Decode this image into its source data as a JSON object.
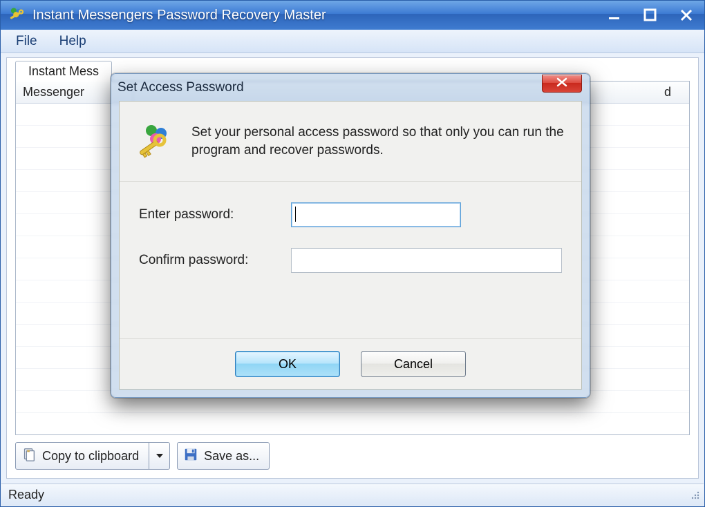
{
  "main_window": {
    "title": "Instant Messengers Password Recovery Master",
    "menubar": {
      "file": "File",
      "help": "Help"
    },
    "tabs": [
      {
        "label": "Instant Mess"
      }
    ],
    "columns": {
      "messenger": "Messenger",
      "right": "d"
    },
    "toolbar": {
      "copy_label": "Copy to clipboard",
      "save_label": "Save as..."
    },
    "status": "Ready"
  },
  "dialog": {
    "title": "Set Access Password",
    "description": "Set your personal access password so that only you can run the program and recover passwords.",
    "enter_label": "Enter password:",
    "confirm_label": "Confirm password:",
    "enter_value": "",
    "confirm_value": "",
    "ok_label": "OK",
    "cancel_label": "Cancel"
  }
}
